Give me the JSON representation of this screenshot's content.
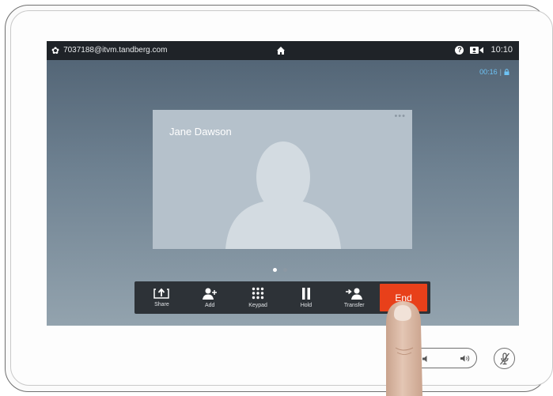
{
  "statusbar": {
    "address": "7037188@itvm.tandberg.com",
    "time": "10:10",
    "icons": [
      "gear-icon",
      "home-icon",
      "help-icon",
      "selfview-icon"
    ]
  },
  "call": {
    "duration": "00:16",
    "encryption_icon": "lock-icon"
  },
  "participant": {
    "name": "Jane Dawson",
    "menu_icon": "more-icon"
  },
  "pager": {
    "pages": 2,
    "active": 1
  },
  "toolbar": {
    "buttons": [
      {
        "label": "Share",
        "icon": "share-icon"
      },
      {
        "label": "Add",
        "icon": "add-participant-icon"
      },
      {
        "label": "Keypad",
        "icon": "keypad-icon"
      },
      {
        "label": "Hold",
        "icon": "pause-icon"
      },
      {
        "label": "Transfer",
        "icon": "transfer-icon"
      }
    ],
    "end_label": "End",
    "end_color": "#e8401a"
  },
  "hardware": {
    "volume_icons": [
      "volume-down-icon",
      "volume-up-icon"
    ],
    "mute_icon": "mic-mute-icon"
  }
}
